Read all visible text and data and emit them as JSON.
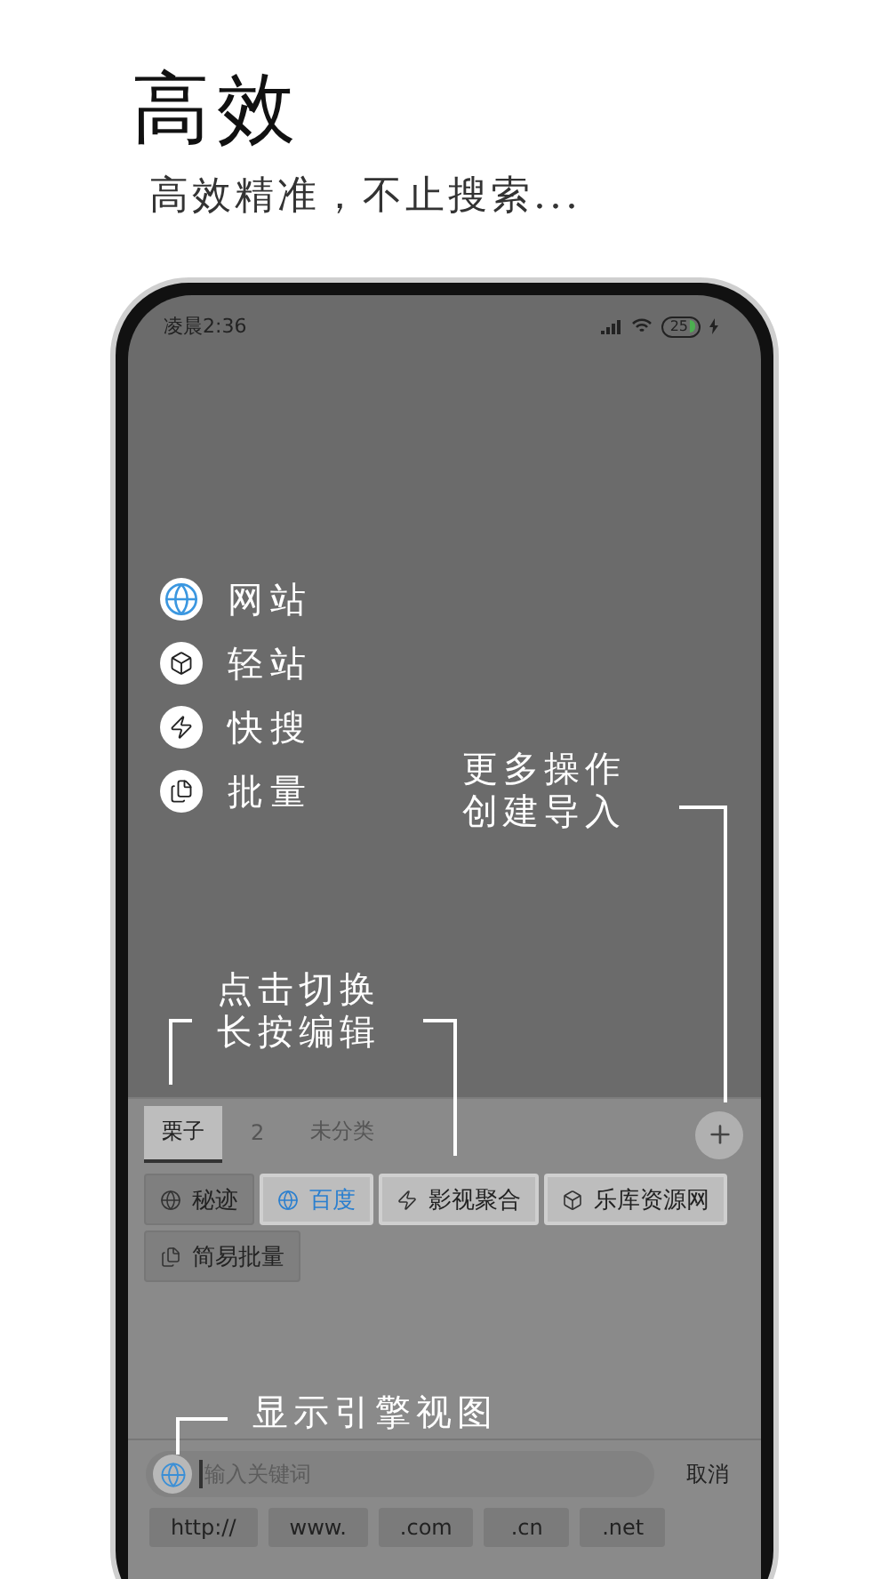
{
  "heading": "高效",
  "subtitle": "高效精准，不止搜索...",
  "status_bar": {
    "time": "凌晨2:36",
    "battery": "25"
  },
  "menu": [
    {
      "label": "网站",
      "kind": "globe"
    },
    {
      "label": "轻站",
      "kind": "cube"
    },
    {
      "label": "快搜",
      "kind": "bolt"
    },
    {
      "label": "批量",
      "kind": "stack"
    }
  ],
  "annotations": [
    {
      "lines": [
        "更多操作",
        "创建导入"
      ]
    },
    {
      "lines": [
        "点击切换",
        "长按编辑"
      ]
    },
    {
      "lines": [
        "显示引擎视图"
      ]
    }
  ],
  "tabs": [
    {
      "label": "栗子",
      "selected": true
    },
    {
      "label": "2",
      "selected": false
    },
    {
      "label": "未分类",
      "selected": false
    }
  ],
  "engines": [
    {
      "label": "秘迹",
      "kind": "globe",
      "selected": false,
      "highlighted": false
    },
    {
      "label": "百度",
      "kind": "globe",
      "selected": true,
      "highlighted": true
    },
    {
      "label": "影视聚合",
      "kind": "bolt",
      "selected": false,
      "highlighted": true
    },
    {
      "label": "乐库资源网",
      "kind": "cube",
      "selected": false,
      "highlighted": true
    },
    {
      "label": "简易批量",
      "kind": "stack",
      "selected": false,
      "highlighted": false
    }
  ],
  "search": {
    "placeholder": "输入关键词",
    "cancel": "取消"
  },
  "quick_inputs": [
    "http://",
    "www.",
    ".com",
    ".cn",
    ".net"
  ]
}
